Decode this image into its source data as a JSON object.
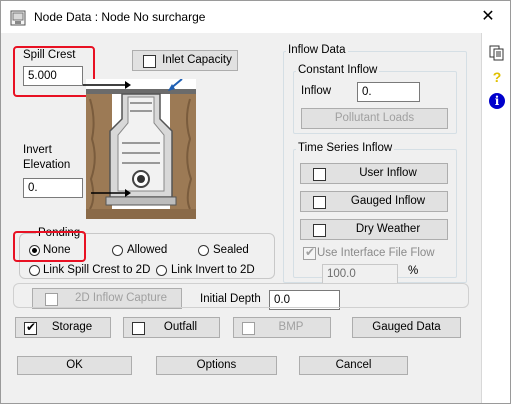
{
  "window": {
    "title": "Node Data : Node No surcharge",
    "close_glyph": "✕"
  },
  "spill_crest": {
    "label": "Spill Crest",
    "value": "5.000"
  },
  "inlet_capacity": {
    "label": "Inlet Capacity"
  },
  "invert_elevation": {
    "label_line1": "Invert",
    "label_line2": "Elevation",
    "value": "0."
  },
  "ponding": {
    "title": "Ponding",
    "options": [
      "None",
      "Allowed",
      "Sealed",
      "Link Spill Crest to 2D",
      "Link Invert to 2D"
    ],
    "selected": "None"
  },
  "capture_2d": {
    "label": "2D Inflow Capture"
  },
  "initial_depth": {
    "label": "Initial Depth",
    "value": "0.0"
  },
  "inflow_data": {
    "title": "Inflow Data",
    "constant_inflow": {
      "title": "Constant Inflow",
      "inflow_label": "Inflow",
      "inflow_value": "0.",
      "pollutant_button": "Pollutant Loads"
    },
    "time_series": {
      "title": "Time Series Inflow",
      "user_inflow": "User Inflow",
      "gauged_inflow": "Gauged Inflow",
      "dry_weather": "Dry Weather",
      "use_interface": "Use Interface File Flow",
      "percent_value": "100.0",
      "percent_unit": "%"
    }
  },
  "bottom_toggles": {
    "storage": "Storage",
    "outfall": "Outfall",
    "bmp": "BMP",
    "gauged_data": "Gauged Data"
  },
  "footer": {
    "ok": "OK",
    "options": "Options",
    "cancel": "Cancel"
  },
  "side_toolbar": {
    "icons": [
      "copy-icon",
      "help-icon",
      "info-icon"
    ],
    "help_glyph": "?",
    "info_glyph": "i"
  },
  "colors": {
    "highlight": "#e81123",
    "title_bg": "#ffffff",
    "dialog_bg": "#f0f0f0",
    "info_blue": "#0000cc",
    "help_yellow": "#e0c000"
  }
}
